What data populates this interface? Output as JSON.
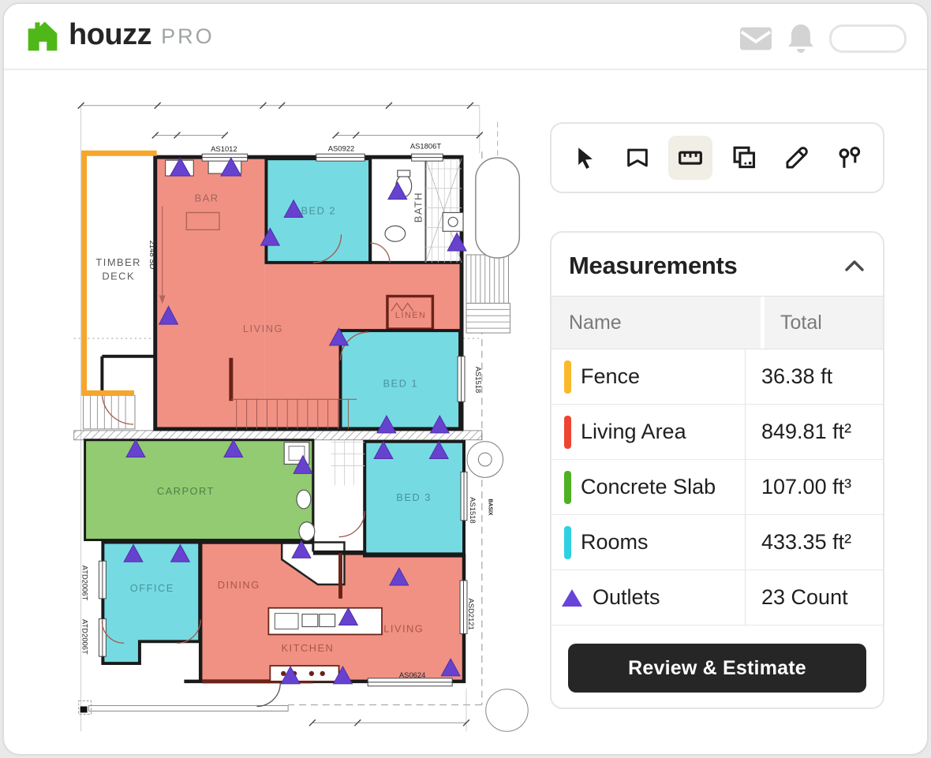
{
  "header": {
    "brand": "houzz",
    "brand_suffix": "PRO",
    "icons": [
      "mail-icon",
      "bell-icon",
      "profile-pill"
    ]
  },
  "toolbar": {
    "tools": [
      {
        "id": "select",
        "icon": "cursor-icon",
        "active": false
      },
      {
        "id": "annotate",
        "icon": "flag-icon",
        "active": false
      },
      {
        "id": "measure",
        "icon": "ruler-icon",
        "active": true
      },
      {
        "id": "takeoff-pages",
        "icon": "pages-icon",
        "active": false
      },
      {
        "id": "draw",
        "icon": "pen-icon",
        "active": false
      },
      {
        "id": "pin-count",
        "icon": "pins-icon",
        "active": false
      }
    ]
  },
  "measurements": {
    "title": "Measurements",
    "collapse_icon": "chevron-up-icon",
    "columns": {
      "name": "Name",
      "total": "Total"
    },
    "rows": [
      {
        "name": "Fence",
        "total": "36.38 ft",
        "color": "#F9B92B",
        "marker": "bar"
      },
      {
        "name": "Living Area",
        "total": "849.81 ft²",
        "color": "#EE4533",
        "marker": "bar"
      },
      {
        "name": "Concrete Slab",
        "total": "107.00 ft³",
        "color": "#4EB022",
        "marker": "bar"
      },
      {
        "name": "Rooms",
        "total": "433.35 ft²",
        "color": "#2ED1E1",
        "marker": "bar"
      },
      {
        "name": "Outlets",
        "total": "23 Count",
        "color": "#6A44D8",
        "marker": "triangle"
      }
    ],
    "cta_label": "Review & Estimate"
  },
  "plan": {
    "overlay_colors": {
      "fence_line": "#F6A62B",
      "living_area_fill": "#F19184",
      "rooms_fill": "#76DAE2",
      "concrete_fill": "#92CB72",
      "outlet_marker": "#6742CF"
    },
    "outlet_count": 23,
    "room_labels": [
      "BAR",
      "BED 2",
      "BATH",
      "TIMBER",
      "DECK",
      "LIVING",
      "LINEN",
      "BED 1",
      "CARPORT",
      "BED 3",
      "OFFICE",
      "DINING",
      "KITCHEN",
      "LIVING"
    ],
    "code_labels": [
      "AS1012",
      "AS0922",
      "AS1806T",
      "2148 SD",
      "AS1518",
      "AS1518",
      "BASIX",
      "ASD2121",
      "AS0624",
      "ATD2006T",
      "ATD2006T"
    ]
  }
}
